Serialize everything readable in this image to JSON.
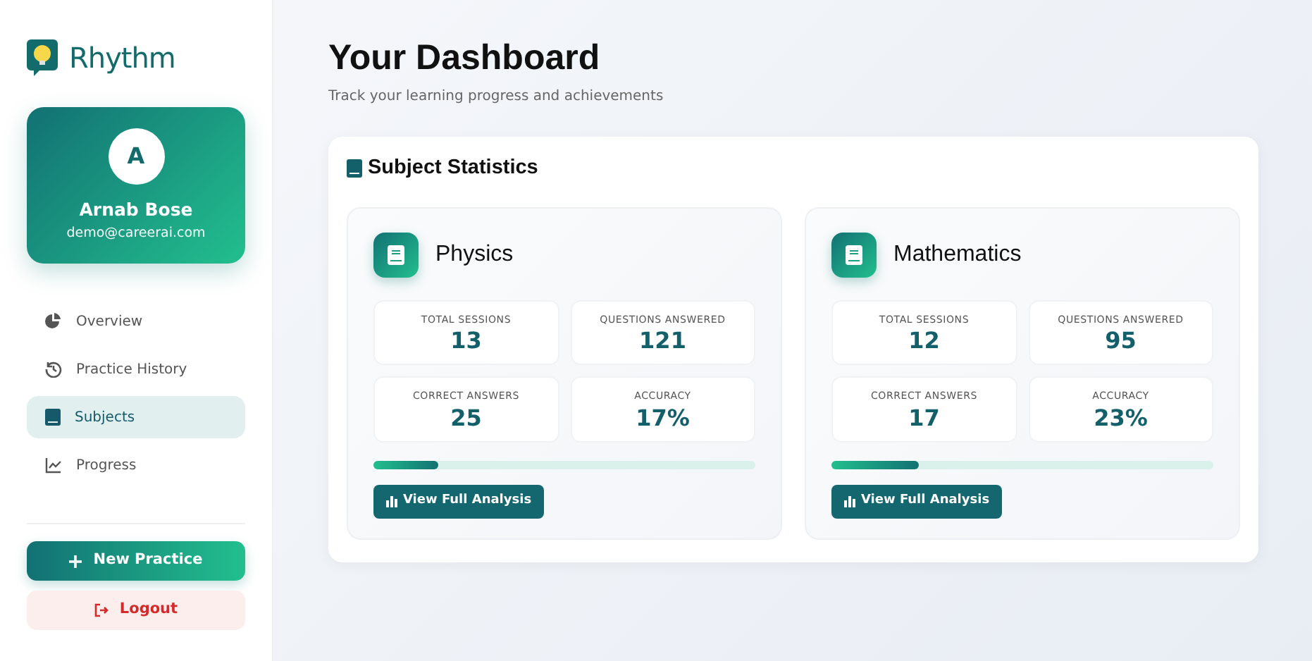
{
  "brand": {
    "name": "Rhythm"
  },
  "profile": {
    "initial": "A",
    "name": "Arnab Bose",
    "email": "demo@careerai.com"
  },
  "nav": [
    {
      "label": "Overview",
      "selected": false
    },
    {
      "label": "Practice History",
      "selected": false
    },
    {
      "label": "Subjects",
      "selected": true
    },
    {
      "label": "Progress",
      "selected": false
    }
  ],
  "new_practice": "New Practice",
  "logout": "Logout",
  "header": {
    "title": "Your Dashboard",
    "subtitle": "Track your learning progress and achievements"
  },
  "section": {
    "title": "Subject Statistics"
  },
  "subjects": [
    {
      "name": "Physics",
      "stats": [
        {
          "label": "TOTAL SESSIONS",
          "value": "13"
        },
        {
          "label": "QUESTIONS ANSWERED",
          "value": "121"
        },
        {
          "label": "CORRECT ANSWERS",
          "value": "25"
        },
        {
          "label": "ACCURACY",
          "value": "17%"
        }
      ],
      "level": 0.17,
      "button": "View Full Analysis"
    },
    {
      "name": "Mathematics",
      "stats": [
        {
          "label": "TOTAL SESSIONS",
          "value": "12"
        },
        {
          "label": "QUESTIONS ANSWERED",
          "value": "95"
        },
        {
          "label": "CORRECT ANSWERS",
          "value": "17"
        },
        {
          "label": "ACCURACY",
          "value": "23%"
        }
      ],
      "level": 0.23,
      "button": "View Full Analysis"
    }
  ]
}
